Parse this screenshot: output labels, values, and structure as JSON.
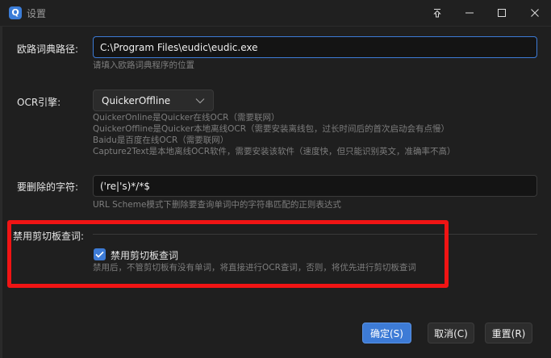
{
  "window": {
    "title": "设置",
    "app_icon_glyph": "Q"
  },
  "colors": {
    "accent": "#3d7bd6",
    "highlight": "#f01414",
    "background": "#1f1f1f"
  },
  "eudic_path": {
    "label": "欧路词典路径:",
    "value": "C:\\Program Files\\eudic\\eudic.exe",
    "hint": "请填入欧路词典程序的位置"
  },
  "ocr_engine": {
    "label": "OCR引擎:",
    "selected": "QuickerOffline",
    "hints": [
      "QuickerOnline是Quicker在线OCR（需要联网）",
      "QuickerOffline是Quicker本地离线OCR（需要安装离线包，过长时间后的首次启动会有点慢）",
      "Baidu是百度在线OCR（需要联网）",
      "Capture2Text是本地离线OCR软件，需要安装该软件（速度快，但只能识别英文，准确率不高）"
    ]
  },
  "remove_chars": {
    "label": "要删除的字符:",
    "value": "('re|'s)*/*$",
    "hint": "URL Scheme模式下删除要查询单词中的字符串匹配的正则表达式"
  },
  "clipboard": {
    "section_label": "禁用剪切板查词:",
    "checkbox_label": "禁用剪切板查词",
    "checked": true,
    "hint": "禁用后，不管剪切板有没有单词，将直接进行OCR查词，否则，将优先进行剪切板查词"
  },
  "buttons": {
    "ok": "确定(S)",
    "cancel": "取消(C)",
    "reset": "重置(R)"
  }
}
